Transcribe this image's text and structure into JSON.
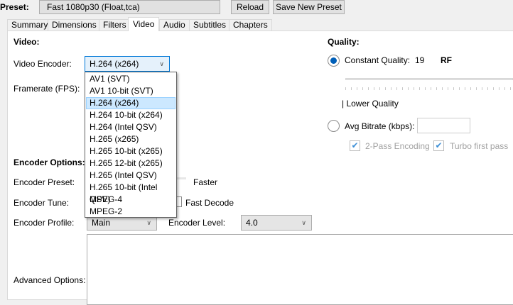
{
  "top": {
    "preset_label": "Preset:",
    "preset_value": "Fast 1080p30 (Float,tca)",
    "reload": "Reload",
    "save_new_preset": "Save New Preset"
  },
  "tabs": [
    "Summary",
    "Dimensions",
    "Filters",
    "Video",
    "Audio",
    "Subtitles",
    "Chapters"
  ],
  "active_tab": "Video",
  "video": {
    "heading": "Video:",
    "encoder_label": "Video Encoder:",
    "encoder_value": "H.264 (x264)",
    "framerate_label": "Framerate (FPS):",
    "encoder_options": [
      "AV1 (SVT)",
      "AV1 10-bit (SVT)",
      "H.264 (x264)",
      "H.264 10-bit (x264)",
      "H.264 (Intel QSV)",
      "H.265 (x265)",
      "H.265 10-bit (x265)",
      "H.265 12-bit (x265)",
      "H.265 (Intel QSV)",
      "H.265 10-bit (Intel QSV)",
      "MPEG-4",
      "MPEG-2"
    ]
  },
  "quality": {
    "heading": "Quality:",
    "constant_quality_label": "Constant Quality:",
    "cq_value": "19",
    "cq_unit": "RF",
    "lower_quality": "| Lower Quality",
    "avg_bitrate_label": "Avg Bitrate (kbps):",
    "avg_bitrate_value": "",
    "two_pass": "2-Pass Encoding",
    "turbo": "Turbo first pass",
    "selected_mode": "constant_quality"
  },
  "encoder": {
    "heading": "Encoder Options:",
    "preset_label": "Encoder Preset:",
    "preset_value": "Faster",
    "tune_label": "Encoder Tune:",
    "fast_decode": "Fast Decode",
    "profile_label": "Encoder Profile:",
    "profile_value": "Main",
    "level_label": "Encoder Level:",
    "level_value": "4.0",
    "advanced_label": "Advanced Options:",
    "advanced_value": ""
  },
  "colors": {
    "accent": "#005fb8",
    "selection": "#cce8ff"
  }
}
